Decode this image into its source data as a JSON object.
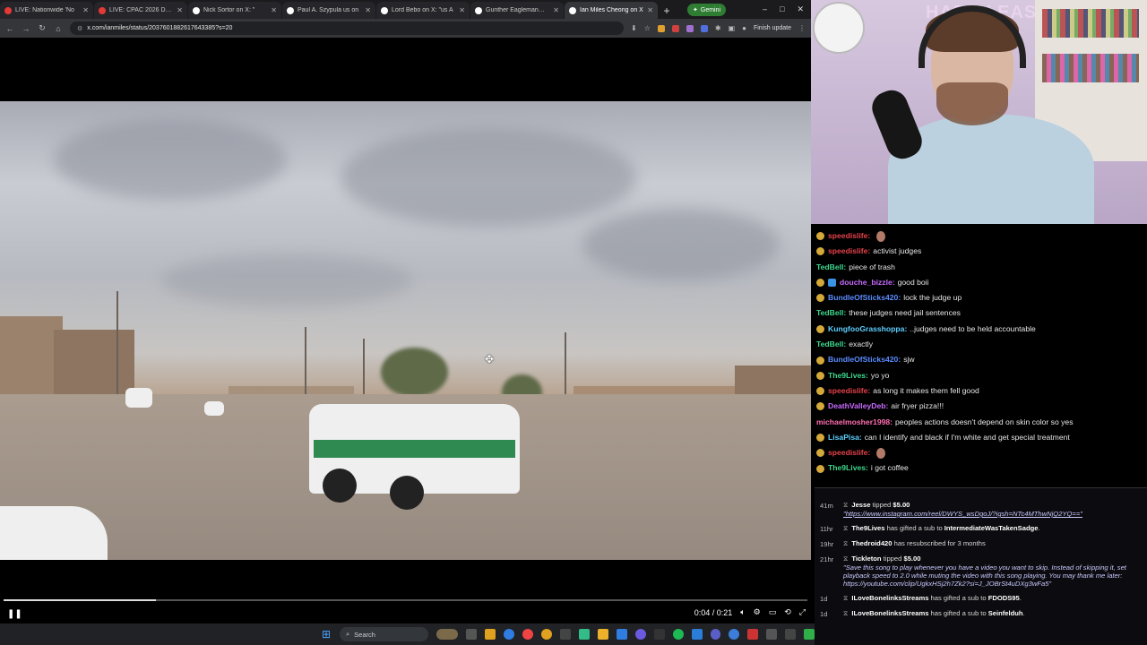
{
  "browser": {
    "tabs": [
      {
        "title": "LIVE: Nationwide 'No",
        "color": "#e53935",
        "active": false
      },
      {
        "title": "LIVE: CPAC 2026 Day Thre",
        "color": "#e53935",
        "active": false
      },
      {
        "title": "Nick Sortor on X: \"",
        "color": "#ffffff",
        "active": false
      },
      {
        "title": "Paul A. Szypula us on",
        "color": "#ffffff",
        "active": false
      },
      {
        "title": "Lord Bebo on X: \"us A",
        "color": "#ffffff",
        "active": false
      },
      {
        "title": "Gunther Eagleman™ o",
        "color": "#ffffff",
        "active": false
      },
      {
        "title": "Ian Miles Cheong on X",
        "color": "#ffffff",
        "active": true
      }
    ],
    "new_tab": "+",
    "gemini_label": "Gemini",
    "url": "x.com/ianmiles/status/2037601882617643385?s=20",
    "finish_update": "Finish update",
    "window_controls": [
      "–",
      "□",
      "✕"
    ]
  },
  "video": {
    "progress": 0.19,
    "time_display": "0:04 / 0:21",
    "play_state_icon": "pause-icon"
  },
  "webcam": {
    "banner_text": "HAPPY EAS"
  },
  "chat": {
    "messages": [
      {
        "user": "speedislife:",
        "color": "#e5424a",
        "badge": "gold",
        "text": "",
        "emote": true
      },
      {
        "user": "speedislife:",
        "color": "#e5424a",
        "badge": "gold",
        "text": "activist judges",
        "emote": false
      },
      {
        "user": "TedBell:",
        "color": "#3dd68c",
        "badge": "none",
        "text": "piece of trash",
        "emote": false
      },
      {
        "user": "douche_bizzle:",
        "color": "#c86bff",
        "badge": "gold+blue",
        "text": "good boii",
        "emote": false
      },
      {
        "user": "BundleOfSticks420:",
        "color": "#5b8cff",
        "badge": "gold",
        "text": "lock the judge up",
        "emote": false
      },
      {
        "user": "TedBell:",
        "color": "#3dd68c",
        "badge": "none",
        "text": "these judges need jail sentences",
        "emote": false
      },
      {
        "user": "KungfooGrasshoppa:",
        "color": "#5dd0ff",
        "badge": "gold",
        "text": "..judges need to be held accountable",
        "emote": false
      },
      {
        "user": "TedBell:",
        "color": "#3dd68c",
        "badge": "none",
        "text": "exactly",
        "emote": false
      },
      {
        "user": "BundleOfSticks420:",
        "color": "#5b8cff",
        "badge": "gold",
        "text": "sjw",
        "emote": false
      },
      {
        "user": "The9Lives:",
        "color": "#3dd68c",
        "badge": "gold",
        "text": "yo yo",
        "emote": false
      },
      {
        "user": "speedislife:",
        "color": "#e5424a",
        "badge": "gold",
        "text": "as long it makes them fell good",
        "emote": false
      },
      {
        "user": "DeathValleyDeb:",
        "color": "#c86bff",
        "badge": "gold",
        "text": "air fryer pizza!!!",
        "emote": false
      },
      {
        "user": "michaelmosher1998:",
        "color": "#ff6fb1",
        "badge": "none",
        "text": "peoples actions doesn't depend on skin color so yes",
        "emote": false
      },
      {
        "user": "LisaPisa:",
        "color": "#5dd0ff",
        "badge": "gold",
        "text": "can I identify and black if I'm white and get special treatment",
        "emote": false
      },
      {
        "user": "speedislife:",
        "color": "#e5424a",
        "badge": "gold",
        "text": "",
        "emote": true
      },
      {
        "user": "The9Lives:",
        "color": "#3dd68c",
        "badge": "gold",
        "text": "i got coffee",
        "emote": false
      }
    ]
  },
  "events": [
    {
      "ago": "41m",
      "parts": [
        {
          "t": "Jesse",
          "b": true
        },
        {
          "t": " tipped ",
          "b": false
        },
        {
          "t": "$5.00",
          "b": true
        }
      ],
      "link": "\"https://www.instagram.com/reel/DWYS_wsDgoJ/?igsh=NTc4MThwNjQ2YQ==\"",
      "note": ""
    },
    {
      "ago": "11hr",
      "parts": [
        {
          "t": "The9Lives",
          "b": true
        },
        {
          "t": " has gifted a sub to ",
          "b": false
        },
        {
          "t": "IntermediateWasTakenSadge",
          "b": true
        },
        {
          "t": ".",
          "b": false
        }
      ],
      "link": "",
      "note": ""
    },
    {
      "ago": "19hr",
      "parts": [
        {
          "t": "Thedroid420",
          "b": true
        },
        {
          "t": " has resubscribed for 3 months",
          "b": false
        }
      ],
      "link": "",
      "note": ""
    },
    {
      "ago": "21hr",
      "parts": [
        {
          "t": "Tickleton",
          "b": true
        },
        {
          "t": " tipped ",
          "b": false
        },
        {
          "t": "$5.00",
          "b": true
        }
      ],
      "link": "",
      "note": "\"Save this song to play whenever you have a video you want to skip. Instead of skipping it, set playback speed to 2.0 while muting the video with this song playing. You may thank me later: https://youtube.com/clip/UgkxHSj2h7Zk2?si=J_JOBrSt4uDXg3wFa5\""
    },
    {
      "ago": "1d",
      "parts": [
        {
          "t": "ILoveBonelinksStreams",
          "b": true
        },
        {
          "t": " has gifted a sub to ",
          "b": false
        },
        {
          "t": "FDODS95",
          "b": true
        },
        {
          "t": ".",
          "b": false
        }
      ],
      "link": "",
      "note": ""
    },
    {
      "ago": "1d",
      "parts": [
        {
          "t": "ILoveBonelinksStreams",
          "b": true
        },
        {
          "t": " has gifted a sub to ",
          "b": false
        },
        {
          "t": "Seinfelduh",
          "b": true
        },
        {
          "t": ".",
          "b": false
        }
      ],
      "link": "",
      "note": ""
    }
  ],
  "taskbar": {
    "search_placeholder": "Search",
    "icons": [
      "windows-start-icon",
      "widget-icon",
      "file-explorer-icon",
      "edge-icon",
      "chrome-icon",
      "chrome-alt-icon",
      "calculator-icon",
      "folder-icon",
      "terminal-icon",
      "chrome-canary-icon",
      "notion-icon",
      "spotify-icon",
      "vscode-icon",
      "teams-icon",
      "settings-icon",
      "store-icon",
      "pin-icon",
      "snip-icon",
      "monitor-icon",
      "obs-icon"
    ]
  }
}
